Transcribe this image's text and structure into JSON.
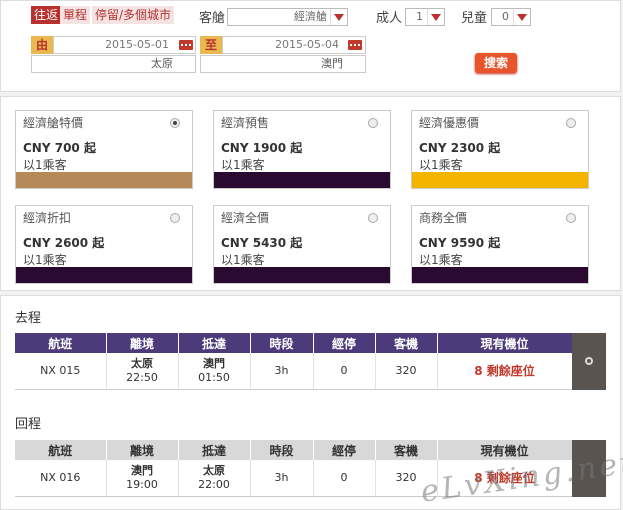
{
  "search": {
    "trip_types": [
      "往返",
      "單程",
      "停留/多個城市"
    ],
    "cabin_label": "客艙",
    "cabin_value": "經濟艙",
    "adult_label": "成人",
    "adult_value": "1",
    "child_label": "兒童",
    "child_value": "0",
    "from_tag": "由",
    "to_tag": "至",
    "depart_date": "2015-05-01",
    "return_date": "2015-05-04",
    "origin_city": "太原",
    "destination_city": "澳門",
    "search_label": "搜索"
  },
  "fares": [
    {
      "name": "經濟艙特價",
      "price": "CNY 700 起",
      "min": "以1乘客",
      "color": "#b5895a",
      "selected": true
    },
    {
      "name": "經濟預售",
      "price": "CNY 1900 起",
      "min": "以1乘客",
      "color": "#2a0a30",
      "selected": false
    },
    {
      "name": "經濟優惠價",
      "price": "CNY 2300 起",
      "min": "以1乘客",
      "color": "#f5b400",
      "selected": false
    },
    {
      "name": "經濟折扣",
      "price": "CNY 2600 起",
      "min": "以1乘客",
      "color": "#2a0a30",
      "selected": false
    },
    {
      "name": "經濟全價",
      "price": "CNY 5430 起",
      "min": "以1乘客",
      "color": "#2a0a30",
      "selected": false
    },
    {
      "name": "商務全價",
      "price": "CNY 9590 起",
      "min": "以1乘客",
      "color": "#2a0a30",
      "selected": false
    }
  ],
  "outbound": {
    "title": "去程",
    "headers": [
      "航班",
      "離境",
      "抵達",
      "時段",
      "經停",
      "客機",
      "現有機位"
    ],
    "row": {
      "flight": "NX 015",
      "dep_city": "太原",
      "dep_time": "22:50",
      "arr_city": "澳門",
      "arr_time": "01:50",
      "duration": "3h",
      "stops": "0",
      "aircraft": "320",
      "seats": "8 剩餘座位"
    }
  },
  "return": {
    "title": "回程",
    "headers": [
      "航班",
      "離境",
      "抵達",
      "時段",
      "經停",
      "客機",
      "現有機位"
    ],
    "row": {
      "flight": "NX 016",
      "dep_city": "澳門",
      "dep_time": "19:00",
      "arr_city": "太原",
      "arr_time": "22:00",
      "duration": "3h",
      "stops": "0",
      "aircraft": "320",
      "seats": "8 剩餘座位"
    }
  },
  "watermark": "eLvXing.net"
}
